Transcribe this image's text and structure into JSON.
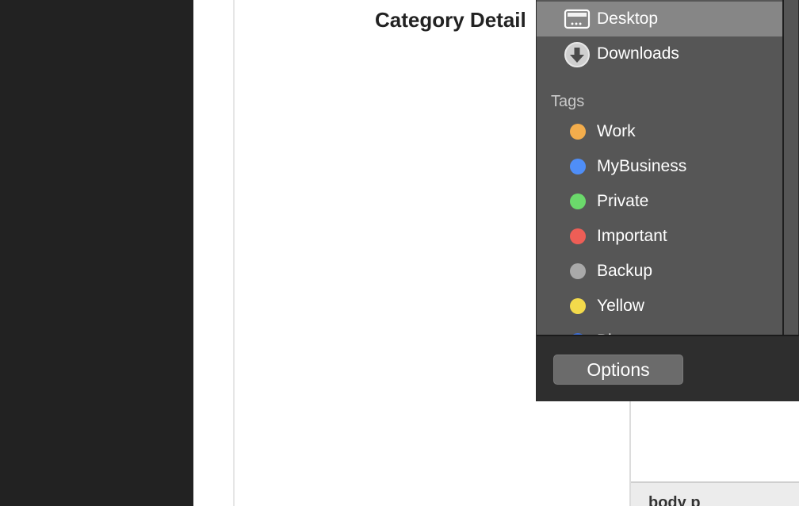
{
  "document": {
    "title": "Category Detail",
    "status_path": "body  p"
  },
  "sidebar": {
    "places": [
      {
        "label": "Desktop",
        "icon": "desktop-icon",
        "selected": true
      },
      {
        "label": "Downloads",
        "icon": "downloads-icon",
        "selected": false
      }
    ],
    "tags_header": "Tags",
    "tags": [
      {
        "label": "Work",
        "color": "#f3ad4c"
      },
      {
        "label": "MyBusiness",
        "color": "#4f8ef7"
      },
      {
        "label": "Private",
        "color": "#6bd96b"
      },
      {
        "label": "Important",
        "color": "#ee5e56"
      },
      {
        "label": "Backup",
        "color": "#a9a9a9"
      },
      {
        "label": "Yellow",
        "color": "#f3da4b"
      },
      {
        "label": "Blue",
        "color": "#3e6fd6"
      }
    ]
  },
  "footer": {
    "options_label": "Options"
  }
}
